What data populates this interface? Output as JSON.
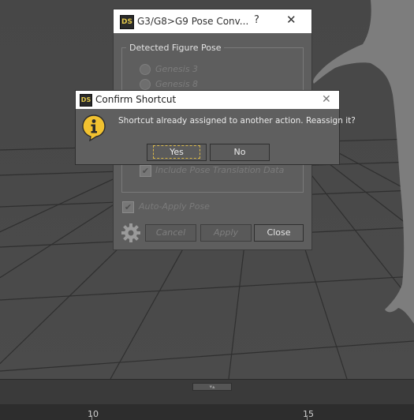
{
  "viewport": {
    "floor_color": "#4a4a4a",
    "grid_color": "#2e2e2e",
    "figure_color": "#7c7c7c"
  },
  "pose_dialog": {
    "logo": "DS",
    "title": "G3/G8>G9 Pose Conv...",
    "help": "?",
    "close": "✕",
    "group_label": "Detected Figure Pose",
    "radios": [
      {
        "label": "Genesis 3"
      },
      {
        "label": "Genesis 8"
      }
    ],
    "include_translation": {
      "label": "Include Pose Translation Data",
      "checked": true
    },
    "auto_apply": {
      "label": "Auto-Apply Pose",
      "checked": true
    },
    "buttons": {
      "cancel": "Cancel",
      "apply": "Apply",
      "close": "Close"
    },
    "icons": {
      "settings": "gear-icon"
    }
  },
  "confirm_dialog": {
    "logo": "DS",
    "title": "Confirm Shortcut",
    "close": "✕",
    "message": "Shortcut already assigned to another action. Reassign it?",
    "buttons": {
      "yes": "Yes",
      "no": "No"
    },
    "icons": {
      "info": "info-icon"
    },
    "info_color": "#f2c230"
  },
  "bottom_bar": {
    "collapse_symbol": "▾▴"
  },
  "timeline": {
    "labels": [
      "10",
      "15"
    ]
  }
}
